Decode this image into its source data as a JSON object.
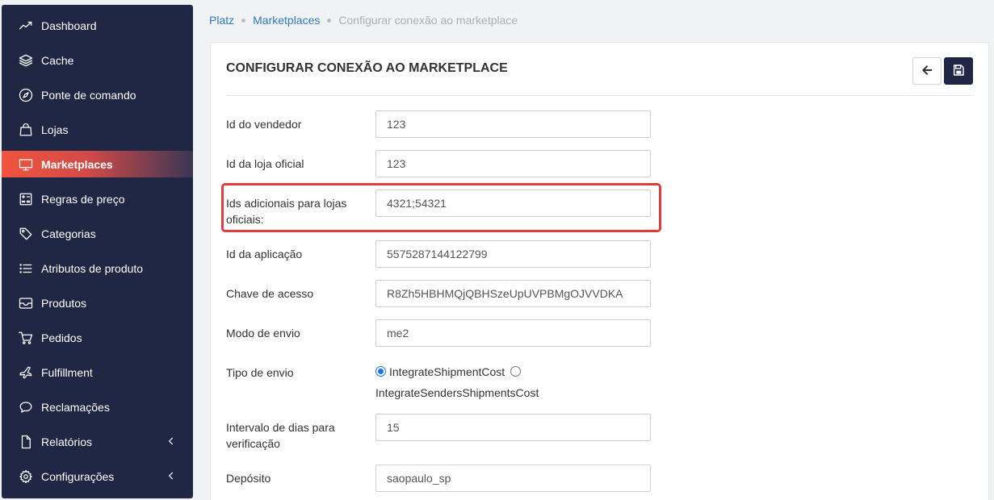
{
  "sidebar": {
    "items": [
      {
        "label": "Dashboard",
        "icon": "trend-line-icon",
        "active": false
      },
      {
        "label": "Cache",
        "icon": "layers-icon",
        "active": false
      },
      {
        "label": "Ponte de comando",
        "icon": "compass-icon",
        "active": false
      },
      {
        "label": "Lojas",
        "icon": "shopping-bag-icon",
        "active": false
      },
      {
        "label": "Marketplaces",
        "icon": "monitor-icon",
        "active": true
      },
      {
        "label": "Regras de preço",
        "icon": "calculator-icon",
        "active": false
      },
      {
        "label": "Categorias",
        "icon": "tag-icon",
        "active": false
      },
      {
        "label": "Atributos de produto",
        "icon": "list-icon",
        "active": false
      },
      {
        "label": "Produtos",
        "icon": "inbox-icon",
        "active": false
      },
      {
        "label": "Pedidos",
        "icon": "cart-icon",
        "active": false
      },
      {
        "label": "Fulfillment",
        "icon": "plane-icon",
        "active": false
      },
      {
        "label": "Reclamações",
        "icon": "chat-bubble-icon",
        "active": false
      },
      {
        "label": "Relatórios",
        "icon": "document-icon",
        "active": false,
        "expandable": true
      },
      {
        "label": "Configurações",
        "icon": "gear-icon",
        "active": false,
        "expandable": true
      }
    ]
  },
  "breadcrumb": {
    "root": "Platz",
    "parent": "Marketplaces",
    "current": "Configurar conexão ao marketplace"
  },
  "card": {
    "title": "CONFIGURAR CONEXÃO AO MARKETPLACE",
    "back_icon": "arrow-left-icon",
    "save_icon": "floppy-disk-icon"
  },
  "form": {
    "seller_id": {
      "label": "Id do vendedor",
      "value": "123"
    },
    "official_store_id": {
      "label": "Id da loja oficial",
      "value": "123"
    },
    "additional_ids": {
      "label_line1": "Ids adicionais para lojas",
      "label_line2": "oficiais:",
      "value": "4321;54321"
    },
    "app_id": {
      "label": "Id da aplicação",
      "value": "5575287144122799"
    },
    "access_key": {
      "label": "Chave de acesso",
      "value": "R8Zh5HBHMQjQBHSzeUpUVPBMgOJVVDKA"
    },
    "shipping_mode": {
      "label": "Modo de envio",
      "value": "me2"
    },
    "shipping_type": {
      "label": "Tipo de envio",
      "options": [
        "IntegrateShipmentCost",
        "IntegrateSendersShipmentsCost"
      ],
      "selected": "IntegrateShipmentCost"
    },
    "check_interval": {
      "label_line1": "Intervalo de dias para",
      "label_line2": "verificação",
      "value": "15"
    },
    "warehouse": {
      "label": "Depósito",
      "value": "saopaulo_sp"
    }
  },
  "colors": {
    "sidebar_bg": "#1f2745",
    "active_accent": "#f0553f",
    "link": "#2f7bbf",
    "highlight_border": "#e03c3c"
  }
}
